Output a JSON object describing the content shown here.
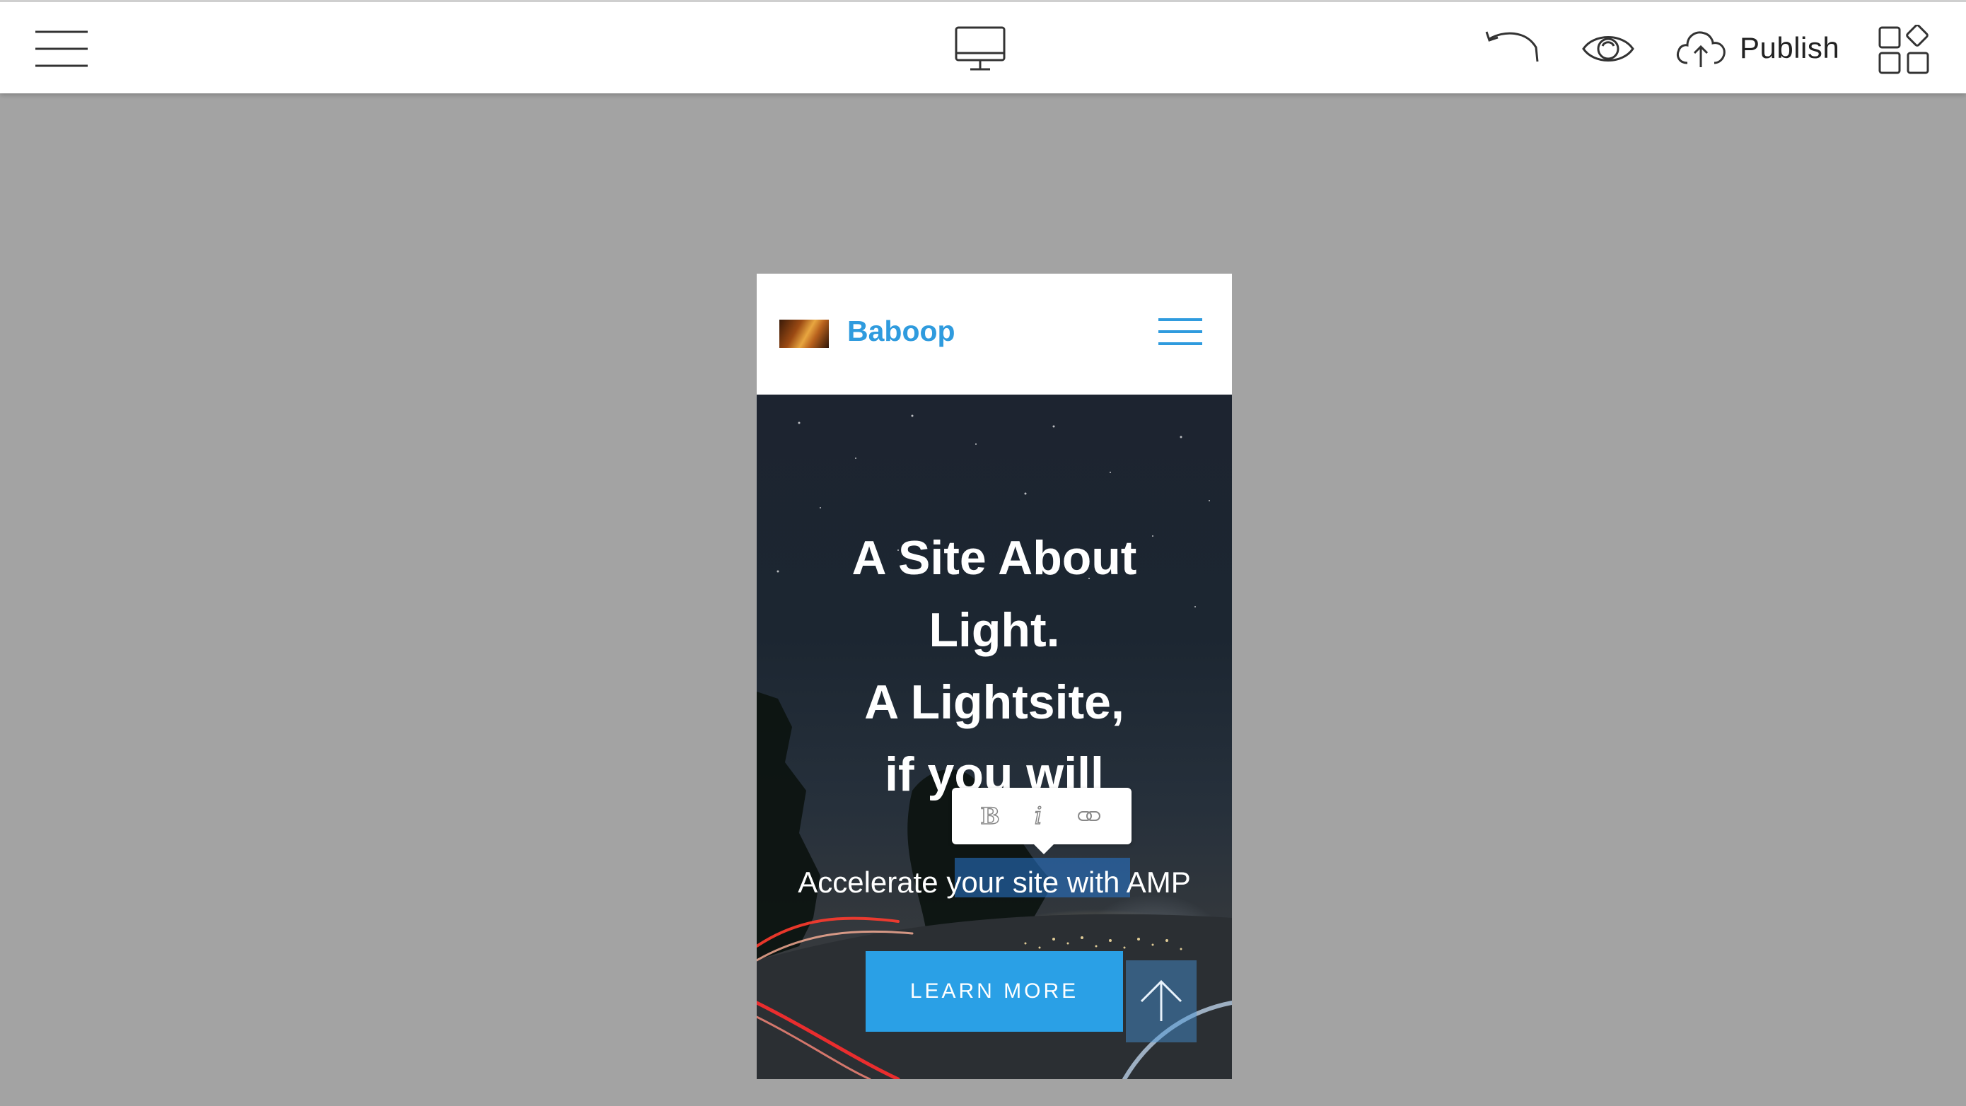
{
  "toolbar": {
    "menu_icon": "hamburger-menu-icon",
    "device_icon": "desktop-monitor-icon",
    "undo_icon": "undo-icon",
    "preview_icon": "eye-icon",
    "publish_icon": "cloud-upload-icon",
    "publish_label": "Publish",
    "blocks_icon": "blocks-grid-icon"
  },
  "site": {
    "brand": "Baboop",
    "brand_color": "#2f9bde",
    "menu_icon": "hamburger-menu-icon",
    "hero": {
      "title_lines": [
        "A Site About",
        "Light.",
        "A Lightsite,",
        "if you will"
      ],
      "subtitle": "Accelerate your site with AMP",
      "button_label": "LEARN MORE",
      "button_color": "#2aa0e6"
    },
    "format_toolbar": {
      "bold": "B",
      "italic": "i",
      "link_icon": "link-icon"
    },
    "scroll_top_icon": "arrow-up-icon"
  },
  "colors": {
    "canvas_background": "#a3a3a3",
    "toolbar_background": "#ffffff"
  }
}
